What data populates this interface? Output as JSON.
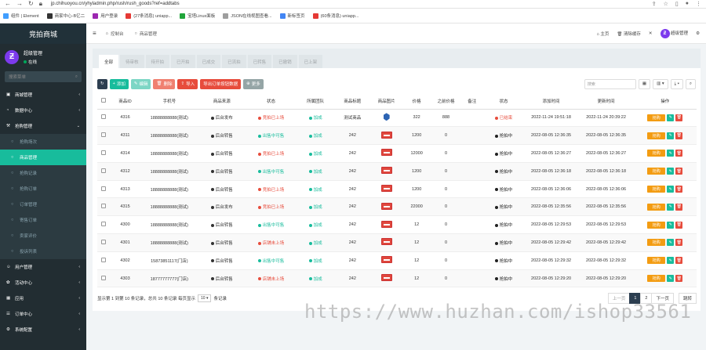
{
  "browser": {
    "url": "jp.chihuoyou.cn/yhyladmin.php/rush/rush_goods?ref=addtabs",
    "bookmarks": [
      {
        "label": "组件 | Element",
        "color": "#409eff"
      },
      {
        "label": "商家中心-B亿二",
        "color": "#333333"
      },
      {
        "label": "用户登录",
        "color": "#9c27b0"
      },
      {
        "label": "(27条消息) uniapp...",
        "color": "#e53935"
      },
      {
        "label": "宝塔Linux面板",
        "color": "#20a53a"
      },
      {
        "label": "JSON在线视图查看...",
        "color": "#9e9e9e"
      },
      {
        "label": "新标签页",
        "color": "#4285f4"
      },
      {
        "label": "(60条消息) uniapp...",
        "color": "#e53935"
      }
    ]
  },
  "sidebar": {
    "brand": "竞拍商城",
    "user_name": "超级管理",
    "user_status": "在线",
    "search_placeholder": "搜索菜单",
    "items": [
      {
        "label": "商城管理",
        "icon": "store-icon",
        "type": "main",
        "caret": "‹"
      },
      {
        "label": "数据中心",
        "icon": "dashboard-icon",
        "type": "main",
        "caret": "‹"
      },
      {
        "label": "抢购管理",
        "icon": "gavel-icon",
        "type": "main",
        "caret": "⌄"
      },
      {
        "label": "抢购场次",
        "icon": "circle-icon",
        "type": "sub"
      },
      {
        "label": "商品管理",
        "icon": "circle-icon",
        "type": "sub active"
      },
      {
        "label": "抢购记录",
        "icon": "circle-icon",
        "type": "sub"
      },
      {
        "label": "抢购订单",
        "icon": "circle-icon",
        "type": "sub"
      },
      {
        "label": "订单管理",
        "icon": "circle-icon",
        "type": "sub"
      },
      {
        "label": "寄售订单",
        "icon": "circle-icon",
        "type": "sub"
      },
      {
        "label": "卖家评价",
        "icon": "circle-icon",
        "type": "sub"
      },
      {
        "label": "投诉列表",
        "icon": "circle-icon",
        "type": "sub"
      },
      {
        "label": "用户管理",
        "icon": "user-icon",
        "type": "main",
        "caret": "‹"
      },
      {
        "label": "活动中心",
        "icon": "gift-icon",
        "type": "main",
        "caret": "‹"
      },
      {
        "label": "应用",
        "icon": "app-icon",
        "type": "main",
        "caret": "‹"
      },
      {
        "label": "订单中心",
        "icon": "list-icon",
        "type": "main",
        "caret": "‹"
      },
      {
        "label": "系统配置",
        "icon": "gear-icon",
        "type": "main",
        "caret": "‹"
      }
    ]
  },
  "topbar": {
    "tabs": [
      "控制台",
      "商品管理"
    ],
    "right": [
      "主页",
      "清除缓存"
    ],
    "admin": "超级管理"
  },
  "content": {
    "tabs": [
      "全部",
      "待审核",
      "待开拍",
      "已开拍",
      "已成交",
      "已流拍",
      "已转售",
      "已撤销",
      "已上架"
    ],
    "toolbar": [
      "添加",
      "编辑",
      "删除",
      "导入",
      "导出订单按钮数据",
      "更多"
    ],
    "search_placeholder": "搜索",
    "columns": [
      "商品ID",
      "手机号",
      "商品来源",
      "状态",
      "所属团队",
      "商品标题",
      "商品图片",
      "价格",
      "之前价格",
      "备注",
      "状态",
      "添加时间",
      "更新时间",
      "操作"
    ],
    "rows": [
      {
        "id": "4316",
        "phone": "18888888888(测试)",
        "source": "后台发布",
        "source_color": "#333333",
        "state": "竞拍已上场",
        "state_color": "#e74c3c",
        "team": "加成",
        "title": "测试商品",
        "img": "blue",
        "price": "322",
        "prev": "888",
        "remark": "",
        "status": "已结束",
        "status_color": "#e74c3c",
        "added": "2022-11-24 19:51:18",
        "updated": "2022-11-24 20:39:22"
      },
      {
        "id": "4311",
        "phone": "18888888888(测试)",
        "source": "后台转售",
        "source_color": "#333333",
        "state": "出售中可售",
        "state_color": "#18bc9c",
        "team": "加成",
        "title": "242",
        "img": "red",
        "price": "1200",
        "prev": "0",
        "remark": "",
        "status": "抢拍中",
        "status_color": "#333333",
        "added": "2022-08-05 12:36:35",
        "updated": "2022-08-05 12:36:35"
      },
      {
        "id": "4314",
        "phone": "18888888888(测试)",
        "source": "后台转售",
        "source_color": "#333333",
        "state": "竞拍已上场",
        "state_color": "#e74c3c",
        "team": "加成",
        "title": "242",
        "img": "red",
        "price": "12000",
        "prev": "0",
        "remark": "",
        "status": "抢拍中",
        "status_color": "#333333",
        "added": "2022-08-05 12:36:27",
        "updated": "2022-08-05 12:36:27"
      },
      {
        "id": "4312",
        "phone": "18888888888(测试)",
        "source": "后台转售",
        "source_color": "#333333",
        "state": "出售中可售",
        "state_color": "#18bc9c",
        "team": "加成",
        "title": "242",
        "img": "red",
        "price": "1200",
        "prev": "0",
        "remark": "",
        "status": "抢拍中",
        "status_color": "#333333",
        "added": "2022-08-05 12:36:18",
        "updated": "2022-08-05 12:36:18"
      },
      {
        "id": "4313",
        "phone": "18888888888(测试)",
        "source": "后台转售",
        "source_color": "#333333",
        "state": "竞拍已上场",
        "state_color": "#e74c3c",
        "team": "加成",
        "title": "242",
        "img": "red",
        "price": "1200",
        "prev": "0",
        "remark": "",
        "status": "抢拍中",
        "status_color": "#333333",
        "added": "2022-08-05 12:36:06",
        "updated": "2022-08-05 12:36:06"
      },
      {
        "id": "4315",
        "phone": "18888888888(测试)",
        "source": "后台发布",
        "source_color": "#333333",
        "state": "竞拍已上场",
        "state_color": "#e74c3c",
        "team": "加成",
        "title": "242",
        "img": "red",
        "price": "22000",
        "prev": "0",
        "remark": "",
        "status": "抢拍中",
        "status_color": "#333333",
        "added": "2022-08-05 12:35:56",
        "updated": "2022-08-05 12:35:56"
      },
      {
        "id": "4300",
        "phone": "18888888888(测试)",
        "source": "后台转售",
        "source_color": "#333333",
        "state": "出售中可售",
        "state_color": "#18bc9c",
        "team": "加成",
        "title": "242",
        "img": "red",
        "price": "12",
        "prev": "0",
        "remark": "",
        "status": "抢拍中",
        "status_color": "#333333",
        "added": "2022-08-05 12:29:53",
        "updated": "2022-08-05 12:29:53"
      },
      {
        "id": "4301",
        "phone": "18888888888(测试)",
        "source": "后台转售",
        "source_color": "#333333",
        "state": "店铺未上场",
        "state_color": "#e74c3c",
        "team": "加成",
        "title": "242",
        "img": "red",
        "price": "12",
        "prev": "0",
        "remark": "",
        "status": "抢拍中",
        "status_color": "#333333",
        "added": "2022-08-05 12:29:42",
        "updated": "2022-08-05 12:29:42"
      },
      {
        "id": "4302",
        "phone": "15873851117(门店)",
        "source": "后台转售",
        "source_color": "#333333",
        "state": "出售中可售",
        "state_color": "#18bc9c",
        "team": "加成",
        "title": "242",
        "img": "red",
        "price": "12",
        "prev": "0",
        "remark": "",
        "status": "抢拍中",
        "status_color": "#333333",
        "added": "2022-08-05 12:29:32",
        "updated": "2022-08-05 12:29:32"
      },
      {
        "id": "4303",
        "phone": "18777777777(门店)",
        "source": "后台转售",
        "source_color": "#333333",
        "state": "店铺未上场",
        "state_color": "#e74c3c",
        "team": "加成",
        "title": "242",
        "img": "red",
        "price": "12",
        "prev": "0",
        "remark": "",
        "status": "抢拍中",
        "status_color": "#333333",
        "added": "2022-08-05 12:29:20",
        "updated": "2022-08-05 12:29:20"
      }
    ],
    "team_color": "#18bc9c",
    "row_actions": {
      "edit": "抢购",
      "pen": "✎",
      "trash": "🗑"
    },
    "footer": {
      "summary": "显示第 1 到第 10 条记录，总共 10 条记录 每页显示",
      "per_page": "10",
      "suffix": "条记录"
    },
    "pager": {
      "prev": "上一页",
      "pages": [
        "1",
        "2"
      ],
      "current": "1",
      "next": "下一页",
      "jump": "跳转"
    }
  },
  "watermark": "https://www.huzhan.com/ishop33561"
}
